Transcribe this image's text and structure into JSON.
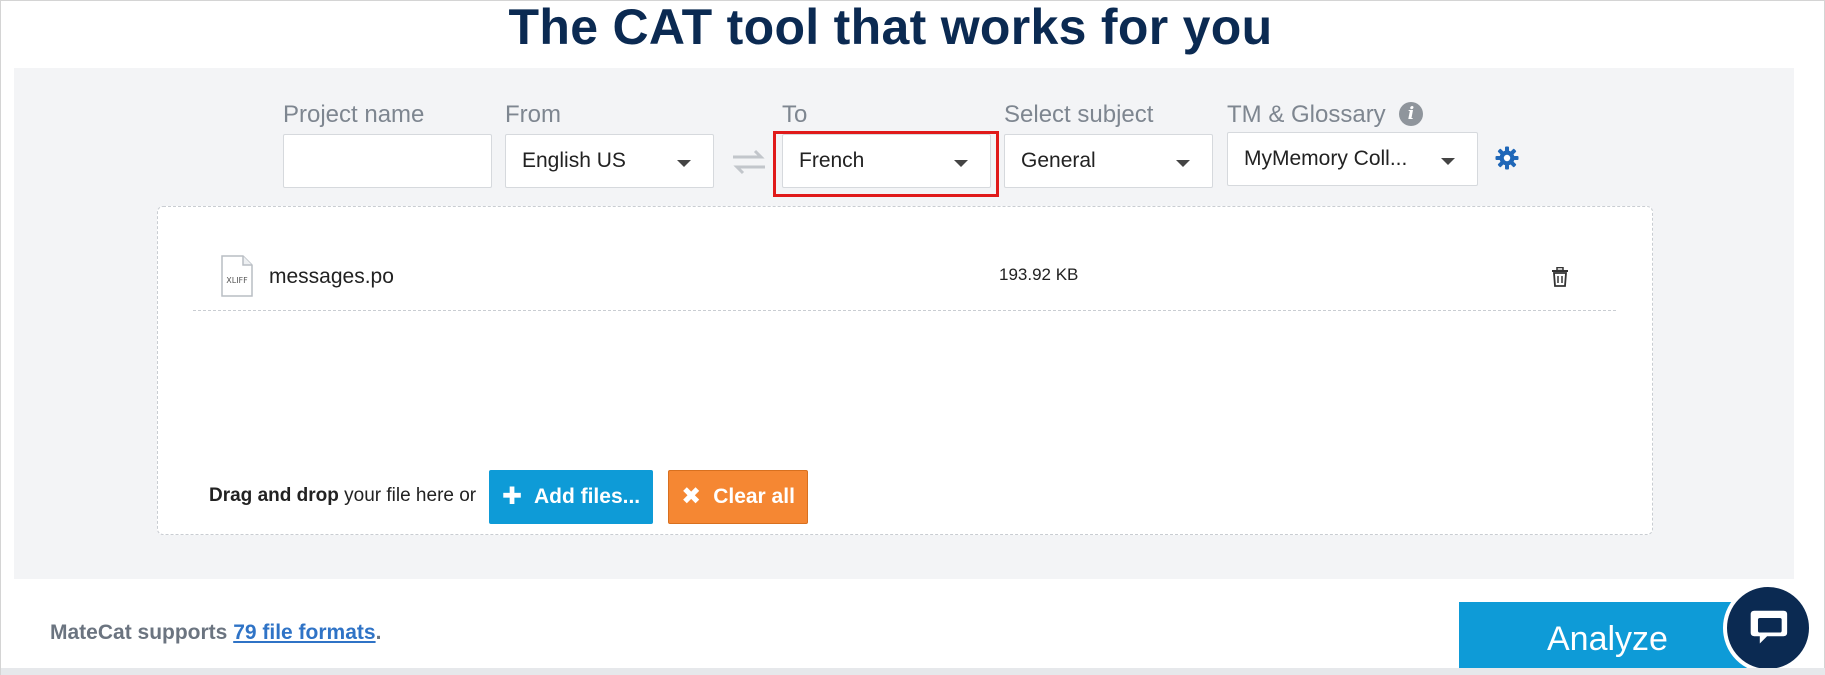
{
  "headline": "The CAT tool that works for you",
  "form": {
    "project_name": {
      "label": "Project name",
      "value": ""
    },
    "from": {
      "label": "From",
      "value": "English US"
    },
    "to": {
      "label": "To",
      "value": "French"
    },
    "subject": {
      "label": "Select subject",
      "value": "General"
    },
    "tm": {
      "label": "TM & Glossary",
      "value": "MyMemory Coll..."
    }
  },
  "files": [
    {
      "type_label": "XLIFF",
      "name": "messages.po",
      "size": "193.92 KB"
    }
  ],
  "dropzone": {
    "drag_bold": "Drag and drop",
    "drag_rest": " your file here or",
    "add_label": "Add files...",
    "clear_label": "Clear all"
  },
  "footer": {
    "supports_prefix": "MateCat supports ",
    "formats_link": "79 file formats",
    "supports_suffix": "."
  },
  "analyze_label": "Analyze",
  "colors": {
    "headline": "#0b2a52",
    "primary_blue": "#0e9bd7",
    "clear_orange": "#f58733",
    "highlight_red": "#e01a1a",
    "gear_blue": "#1f67b8"
  },
  "icons": {
    "swap": "swap-arrows-icon",
    "info": "info-icon",
    "gear": "gear-icon",
    "file": "xliff-file-icon",
    "trash": "trash-icon",
    "plus": "plus-icon",
    "clear": "x-icon",
    "chat": "chat-icon"
  }
}
